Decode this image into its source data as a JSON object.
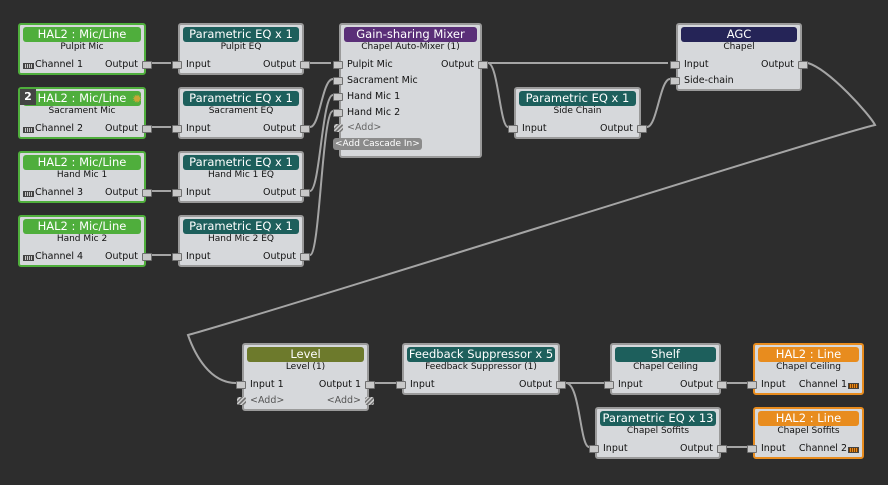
{
  "colors": {
    "background": "#2d2d2d",
    "input_header": "#4fae3c",
    "output_header": "#e88c1e",
    "eq_header": "#1d5f5c",
    "mixer_header": "#5a2f78",
    "agc_header": "#252457",
    "level_header": "#6d7a2c"
  },
  "blocks": {
    "hal_in1": {
      "title": "HAL2 : Mic/Line",
      "name": "Pulpit Mic",
      "left": "Channel 1",
      "right": "Output"
    },
    "hal_in2": {
      "title": "HAL2 : Mic/Line",
      "name": "Sacrament Mic",
      "left": "Channel 2",
      "right": "Output",
      "badge": "2"
    },
    "hal_in3": {
      "title": "HAL2 : Mic/Line",
      "name": "Hand Mic 1",
      "left": "Channel 3",
      "right": "Output"
    },
    "hal_in4": {
      "title": "HAL2 : Mic/Line",
      "name": "Hand Mic 2",
      "left": "Channel 4",
      "right": "Output"
    },
    "peq1": {
      "title": "Parametric EQ x 1",
      "name": "Pulpit EQ",
      "left": "Input",
      "right": "Output"
    },
    "peq2": {
      "title": "Parametric EQ x 1",
      "name": "Sacrament EQ",
      "left": "Input",
      "right": "Output"
    },
    "peq3": {
      "title": "Parametric EQ x 1",
      "name": "Hand Mic 1 EQ",
      "left": "Input",
      "right": "Output"
    },
    "peq4": {
      "title": "Parametric EQ x 1",
      "name": "Hand Mic 2 EQ",
      "left": "Input",
      "right": "Output"
    },
    "mixer": {
      "title": "Gain-sharing Mixer",
      "name": "Chapel Auto-Mixer (1)",
      "inputs": [
        "Pulpit Mic",
        "Sacrament Mic",
        "Hand Mic 1",
        "Hand Mic 2"
      ],
      "add": "<Add>",
      "cascade": "<Add Cascade In>",
      "output": "Output"
    },
    "sidechain": {
      "title": "Parametric EQ x 1",
      "name": "Side Chain",
      "left": "Input",
      "right": "Output"
    },
    "agc": {
      "title": "AGC",
      "name": "Chapel",
      "left": "Input",
      "left2": "Side-chain",
      "right": "Output"
    },
    "level": {
      "title": "Level",
      "name": "Level (1)",
      "left": "Input 1",
      "right": "Output 1",
      "add_left": "<Add>",
      "add_right": "<Add>"
    },
    "fbs": {
      "title": "Feedback Suppressor x 5",
      "name": "Feedback Suppressor (1)",
      "left": "Input",
      "right": "Output"
    },
    "shelf": {
      "title": "Shelf",
      "name": "Chapel Ceiling",
      "left": "Input",
      "right": "Output"
    },
    "peq13": {
      "title": "Parametric EQ x 13",
      "name": "Chapel Soffits",
      "left": "Input",
      "right": "Output"
    },
    "hal_out1": {
      "title": "HAL2 : Line",
      "name": "Chapel Ceiling",
      "left": "Input",
      "right": "Channel 1"
    },
    "hal_out2": {
      "title": "HAL2 : Line",
      "name": "Chapel Soffits",
      "left": "Input",
      "right": "Channel 2"
    }
  }
}
